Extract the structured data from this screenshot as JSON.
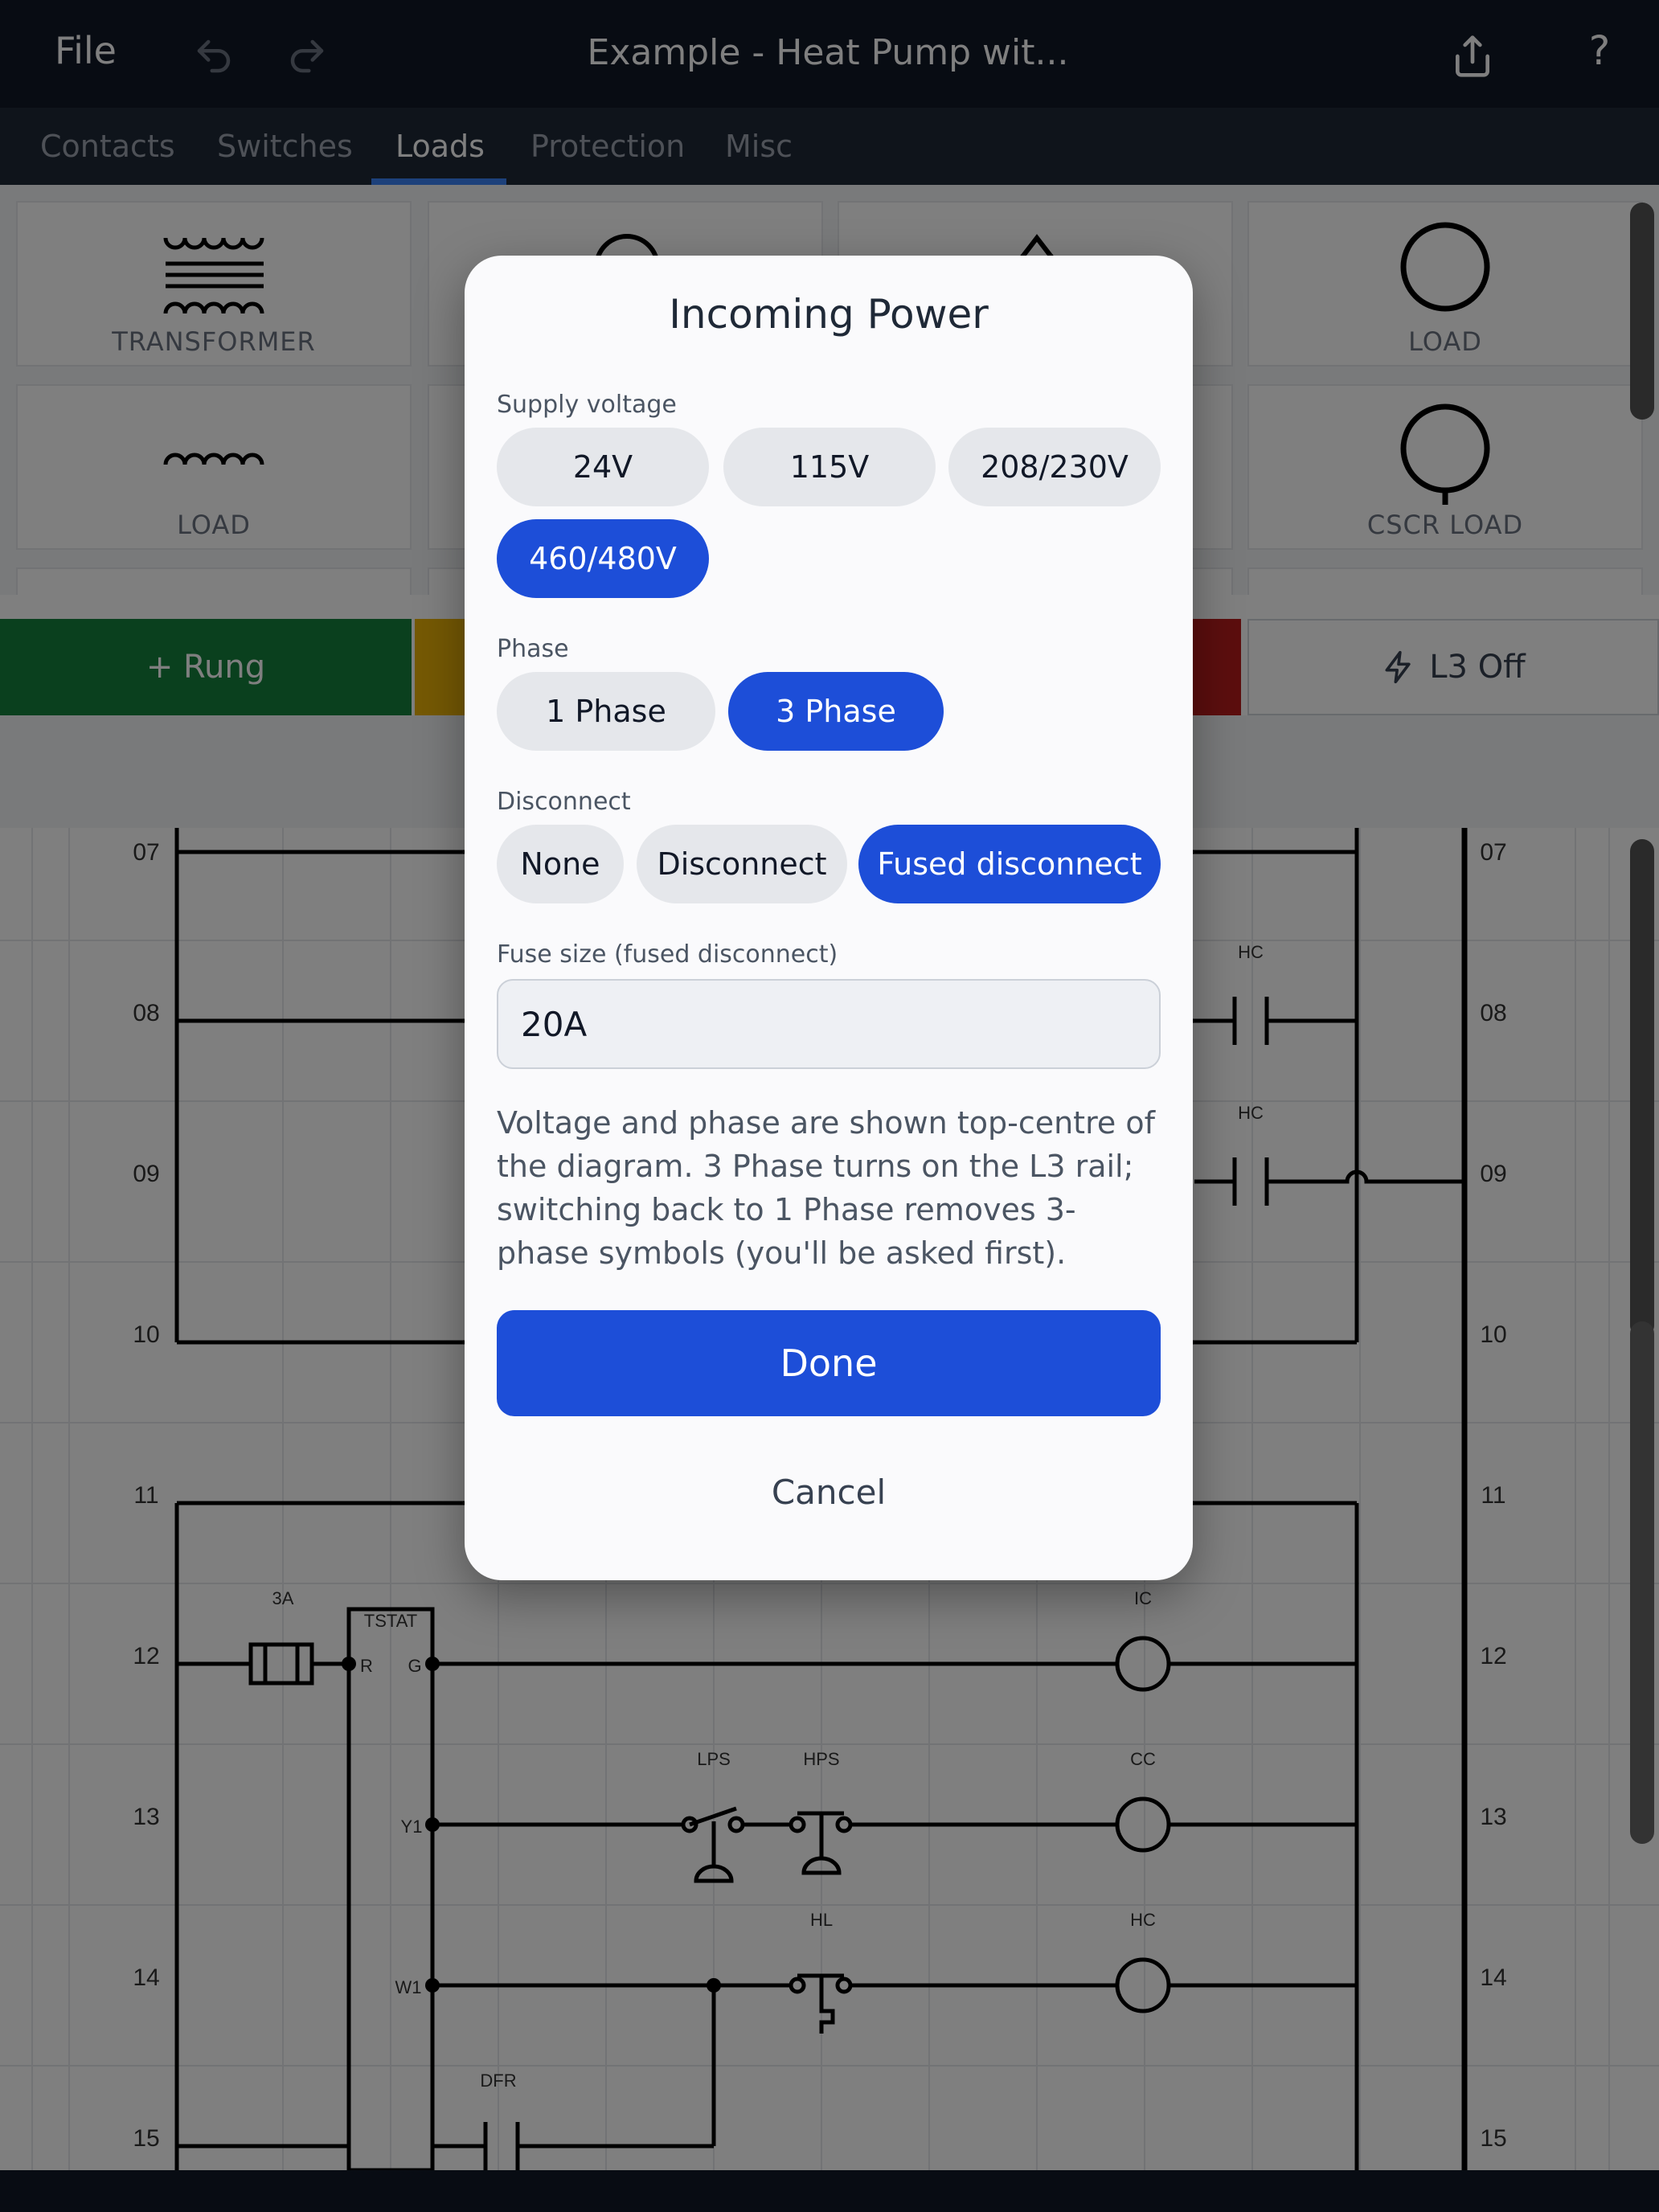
{
  "topbar": {
    "file_label": "File",
    "title": "Example - Heat Pump wit...",
    "help_label": "?"
  },
  "tabs": [
    {
      "label": "Contacts"
    },
    {
      "label": "Switches"
    },
    {
      "label": "Loads",
      "active": true
    },
    {
      "label": "Protection"
    },
    {
      "label": "Misc"
    }
  ],
  "palette": {
    "tiles": [
      {
        "label": "TRANSFORMER",
        "icon": "transformer-icon"
      },
      {
        "label": "",
        "icon": "load-icon"
      },
      {
        "label": "",
        "icon": "load-icon"
      },
      {
        "label": "LOAD",
        "icon": "circle-load-icon"
      },
      {
        "label": "LOAD",
        "icon": "coil-icon"
      },
      {
        "label": "",
        "icon": ""
      },
      {
        "label": "",
        "icon": ""
      },
      {
        "label": "CSCR LOAD",
        "icon": "cscr-load-icon"
      }
    ]
  },
  "actions": {
    "rung_label": "+ Rung",
    "l3_label": "L3 Off"
  },
  "diagram": {
    "rung_numbers": [
      "07",
      "08",
      "09",
      "10",
      "11",
      "12",
      "13",
      "14",
      "15"
    ],
    "component_labels": {
      "hc": "HC",
      "fuse": "3A",
      "tstat": "TSTAT",
      "r": "R",
      "g": "G",
      "y1": "Y1",
      "w1": "W1",
      "ic": "IC",
      "cc": "CC",
      "lps": "LPS",
      "hps": "HPS",
      "hl": "HL",
      "dfr": "DFR"
    }
  },
  "modal": {
    "title": "Incoming Power",
    "supply_label": "Supply voltage",
    "voltages": [
      {
        "label": "24V",
        "selected": false
      },
      {
        "label": "115V",
        "selected": false
      },
      {
        "label": "208/230V",
        "selected": false
      },
      {
        "label": "460/480V",
        "selected": true
      }
    ],
    "phase_label": "Phase",
    "phases": [
      {
        "label": "1 Phase",
        "selected": false
      },
      {
        "label": "3 Phase",
        "selected": true
      }
    ],
    "disconnect_label": "Disconnect",
    "disconnects": [
      {
        "label": "None",
        "selected": false
      },
      {
        "label": "Disconnect",
        "selected": false
      },
      {
        "label": "Fused disconnect",
        "selected": true
      }
    ],
    "fuse_label": "Fuse size (fused disconnect)",
    "fuse_value": "20A",
    "help_text": "Voltage and phase are shown top-centre of the diagram. 3 Phase turns on the L3 rail; switching back to 1 Phase removes 3-phase symbols (you'll be asked first).",
    "done_label": "Done",
    "cancel_label": "Cancel"
  },
  "colors": {
    "accent": "#1d4ed8",
    "rung_green": "#15803d",
    "warn_yellow": "#eab308",
    "danger_red": "#b91c1c",
    "topbar": "#111827"
  }
}
